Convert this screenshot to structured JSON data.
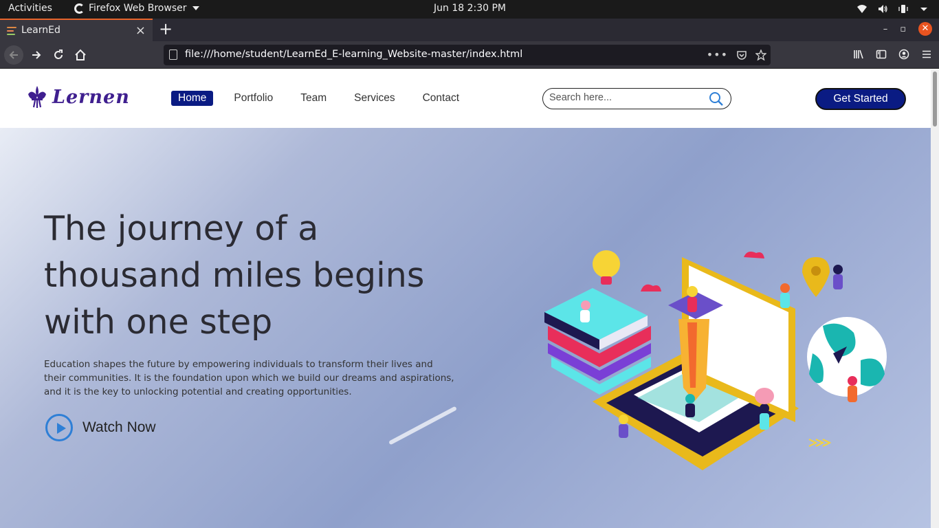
{
  "system": {
    "activities": "Activities",
    "app_name": "Firefox Web Browser",
    "clock": "Jun 18  2:30 PM"
  },
  "browser": {
    "tab_title": "LearnEd",
    "url": "file:///home/student/LearnEd_E-learning_Website-master/index.html"
  },
  "site": {
    "logo_text": "Lernen",
    "nav": [
      "Home",
      "Portfolio",
      "Team",
      "Services",
      "Contact"
    ],
    "active_nav": "Home",
    "search_placeholder": "Search here...",
    "cta": "Get Started",
    "hero_title": "The journey of a thousand miles begins with one step",
    "hero_text": "Education shapes the future by empowering individuals to transform their lives and their communities. It is the foundation upon which we build our dreams and aspirations, and it is the key to unlocking potential and creating opportunities.",
    "watch_label": "Watch Now"
  },
  "colors": {
    "brand": "#0a1b83",
    "logo": "#3f1f8f",
    "accent_blue": "#2e7fd6",
    "tab_indicator": "#e8642b"
  }
}
